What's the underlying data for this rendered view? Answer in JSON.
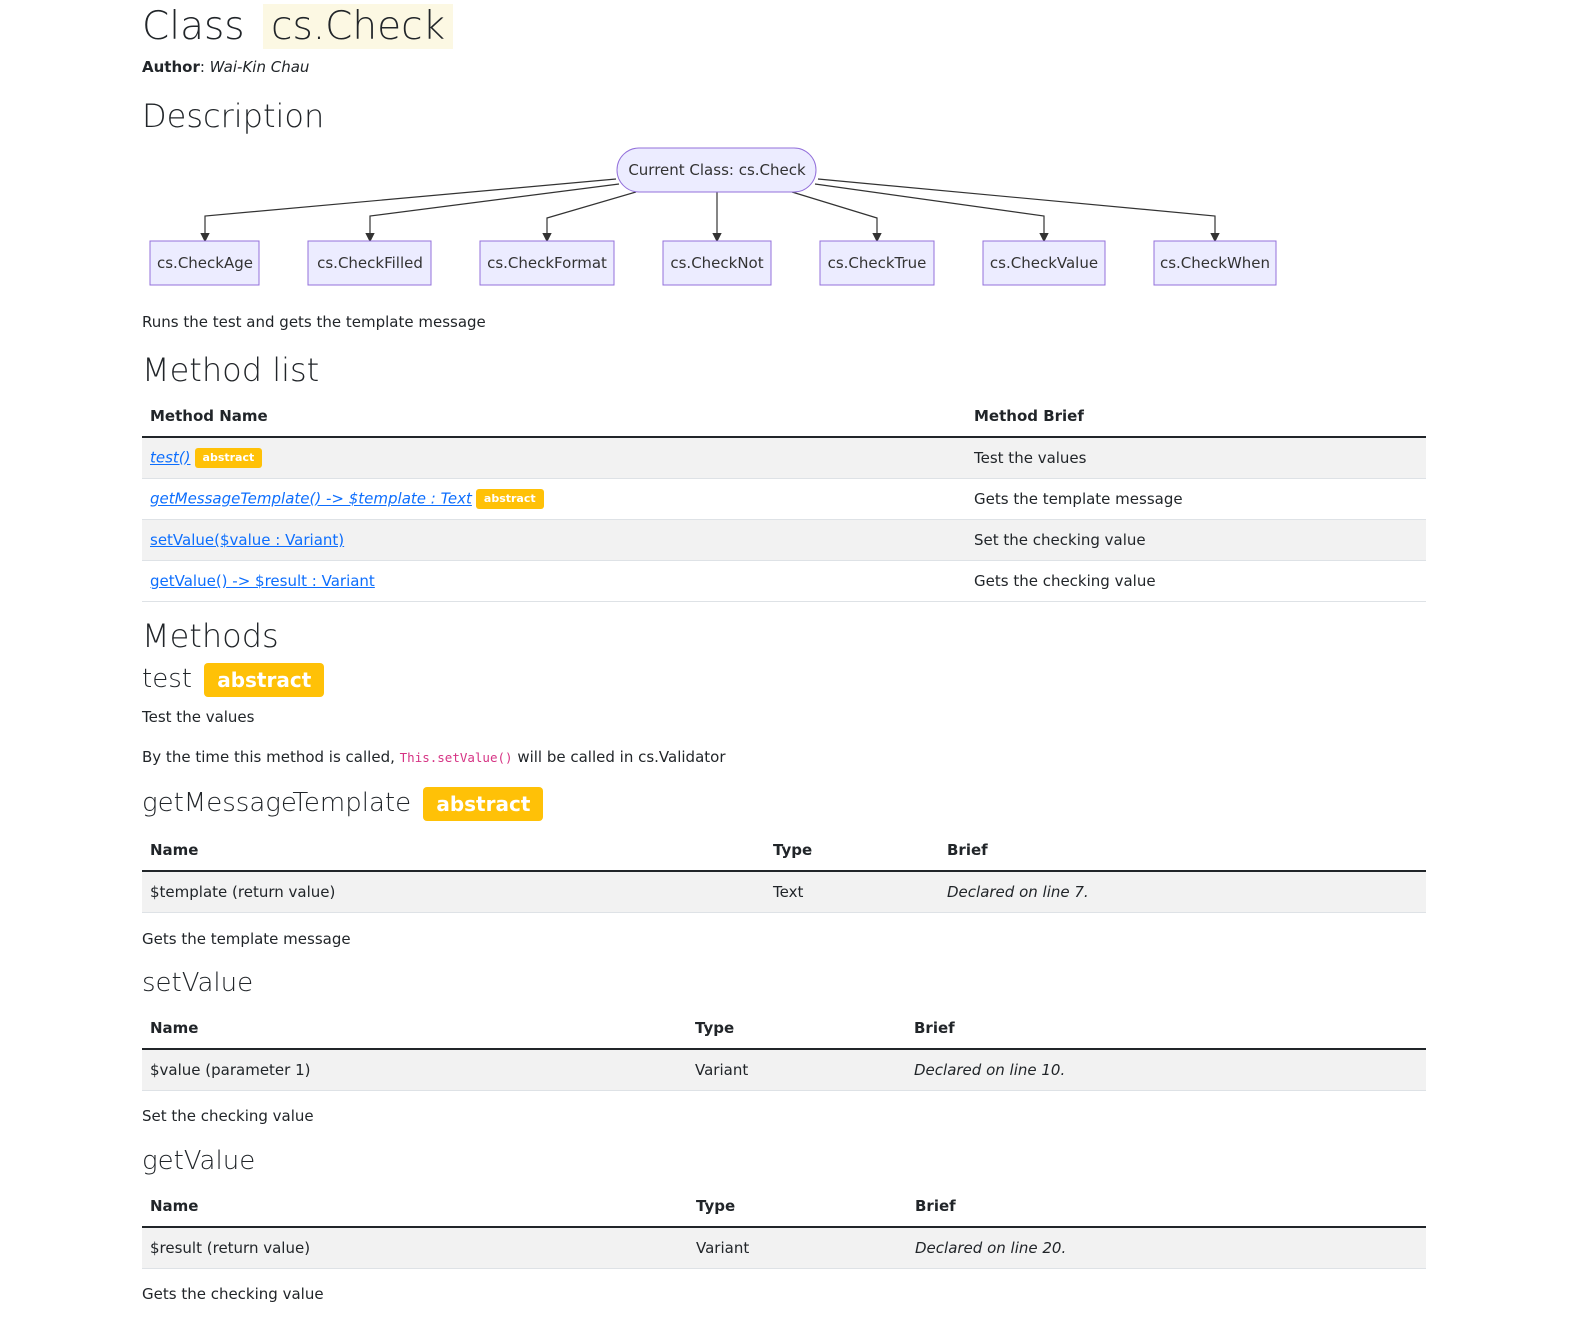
{
  "header": {
    "title_prefix": "Class",
    "class_name": "cs.Check",
    "author_label": "Author",
    "author_name": "Wai-Kin Chau"
  },
  "description": {
    "heading": "Description",
    "diagram": {
      "root": "Current Class: cs.Check",
      "children": [
        "cs.CheckAge",
        "cs.CheckFilled",
        "cs.CheckFormat",
        "cs.CheckNot",
        "cs.CheckTrue",
        "cs.CheckValue",
        "cs.CheckWhen"
      ]
    },
    "text": "Runs the test and gets the template message"
  },
  "method_list": {
    "heading": "Method list",
    "col_name": "Method Name",
    "col_brief": "Method Brief",
    "rows": [
      {
        "name": "test()",
        "badge": "abstract",
        "brief": "Test the values"
      },
      {
        "name": "getMessageTemplate() -> $template : Text",
        "badge": "abstract",
        "brief": "Gets the template message"
      },
      {
        "name": "setValue($value : Variant)",
        "brief": "Set the checking value"
      },
      {
        "name": "getValue() -> $result : Variant",
        "brief": "Gets the checking value"
      }
    ]
  },
  "methods": {
    "heading": "Methods",
    "test": {
      "title": "test",
      "badge": "abstract",
      "desc": "Test the values",
      "note_before": "By the time this method is called,",
      "note_code": "This.setValue()",
      "note_after": "will be called in cs.Validator"
    },
    "getMessageTemplate": {
      "title": "getMessageTemplate",
      "badge": "abstract",
      "col_name": "Name",
      "col_type": "Type",
      "col_brief": "Brief",
      "row": {
        "name": "$template (return value)",
        "type": "Text",
        "brief": "Declared on line 7."
      },
      "desc": "Gets the template message"
    },
    "setValue": {
      "title": "setValue",
      "col_name": "Name",
      "col_type": "Type",
      "col_brief": "Brief",
      "row": {
        "name": "$value (parameter 1)",
        "type": "Variant",
        "brief": "Declared on line 10."
      },
      "desc": "Set the checking value"
    },
    "getValue": {
      "title": "getValue",
      "col_name": "Name",
      "col_type": "Type",
      "col_brief": "Brief",
      "row": {
        "name": "$result (return value)",
        "type": "Variant",
        "brief": "Declared on line 20."
      },
      "desc": "Gets the checking value"
    }
  }
}
